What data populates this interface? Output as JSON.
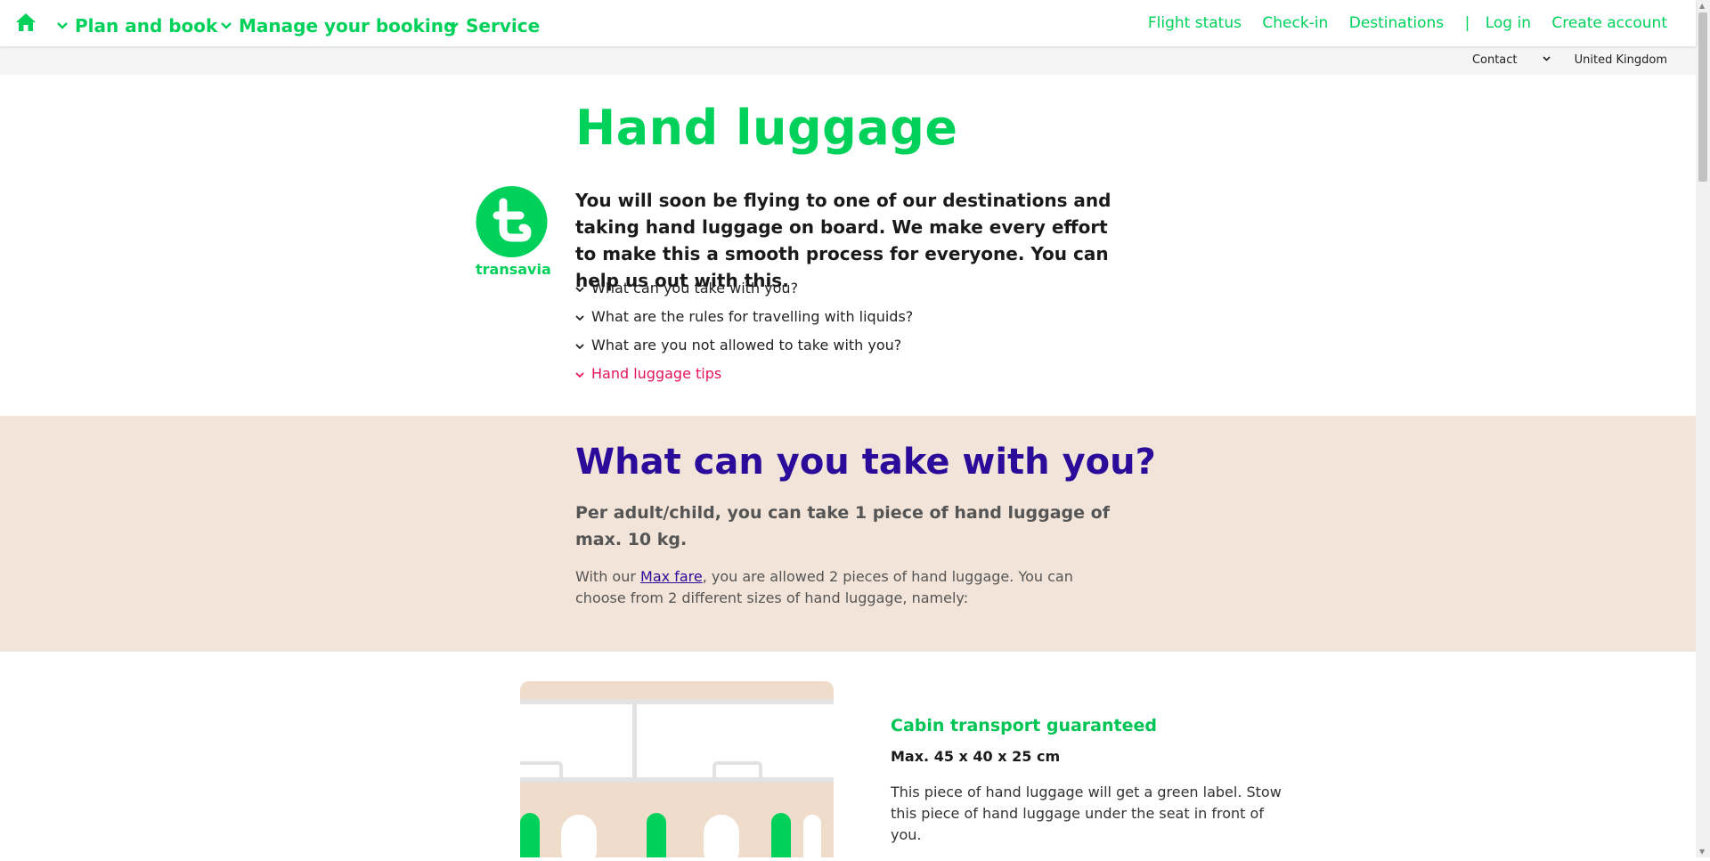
{
  "nav": {
    "home_label": "Home",
    "items": [
      {
        "label": "Plan and book"
      },
      {
        "label": "Manage your booking"
      },
      {
        "label": "Service"
      }
    ],
    "right": {
      "flight_status": "Flight status",
      "check_in": "Check-in",
      "destinations": "Destinations",
      "separator": "|",
      "log_in": "Log in",
      "create_account": "Create account"
    },
    "sub": {
      "contact": "Contact",
      "country": "United Kingdom"
    }
  },
  "brand": {
    "name": "transavia",
    "color": "#00d15a"
  },
  "intro": {
    "title": "Hand luggage",
    "lead": "You will soon be flying to one of our destinations and taking hand luggage on board. We make every effort to make this a smooth process for everyone. You can help us out with this.",
    "anchors": [
      {
        "label": "What can you take with you?",
        "active": false
      },
      {
        "label": "What are the rules for travelling with liquids?",
        "active": false
      },
      {
        "label": "What are you not allowed to take with you?",
        "active": false
      },
      {
        "label": "Hand luggage tips",
        "active": true
      }
    ]
  },
  "section": {
    "heading": "What can you take with you?",
    "subheading": "Per adult/child, you can take 1 piece of hand luggage of max. 10 kg.",
    "body_before": "With our ",
    "body_link": "Max fare",
    "body_after": ", you are allowed 2 pieces of hand luggage. You can choose from 2 different sizes of hand luggage, namely:"
  },
  "card": {
    "title": "Cabin transport guaranteed",
    "dimensions": "Max. 45 x 40 x 25 cm",
    "description": "This piece of hand luggage will get a green label. Stow this piece of hand luggage under the seat in front of you."
  },
  "colors": {
    "green": "#00d15a",
    "purple": "#2b0c9a",
    "pink": "#e5145a",
    "beige": "#f2e4d8"
  }
}
